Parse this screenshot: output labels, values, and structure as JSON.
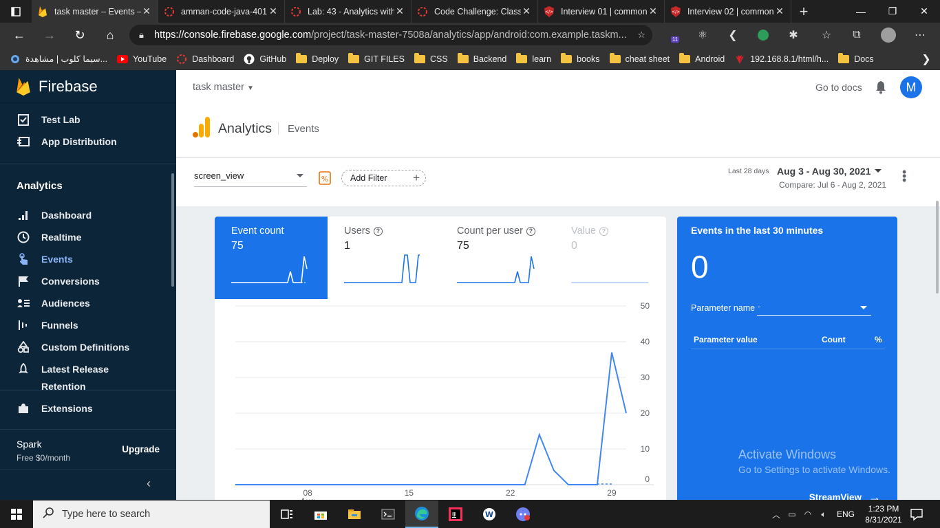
{
  "browser": {
    "tabs": [
      {
        "title": "task master – Events –",
        "icon": "firebase-icon",
        "active": true
      },
      {
        "title": "amman-code-java-401",
        "icon": "loading-ring-icon"
      },
      {
        "title": "Lab: 43 - Analytics with",
        "icon": "loading-ring-icon"
      },
      {
        "title": "Code Challenge: Class",
        "icon": "loading-ring-icon"
      },
      {
        "title": "Interview 01 | common",
        "icon": "code-shield-icon"
      },
      {
        "title": "Interview 02 | common",
        "icon": "code-shield-icon"
      }
    ],
    "url_host": "https://console.firebase.google.com",
    "url_path": "/project/task-master-7508a/analytics/app/android:com.example.taskm...",
    "extension_badge": "11",
    "bookmarks": [
      {
        "label": "سيما كلوب | مشاهدة...",
        "icon": "globe-icon"
      },
      {
        "label": "YouTube",
        "icon": "youtube-icon"
      },
      {
        "label": "Dashboard",
        "icon": "loading-ring-icon"
      },
      {
        "label": "GitHub",
        "icon": "github-icon"
      },
      {
        "label": "Deploy",
        "icon": "folder-icon"
      },
      {
        "label": "GIT FILES",
        "icon": "folder-icon"
      },
      {
        "label": "CSS",
        "icon": "folder-icon"
      },
      {
        "label": "Backend",
        "icon": "folder-icon"
      },
      {
        "label": "learn",
        "icon": "folder-icon"
      },
      {
        "label": "books",
        "icon": "folder-icon"
      },
      {
        "label": "cheat sheet",
        "icon": "folder-icon"
      },
      {
        "label": "Android",
        "icon": "folder-icon"
      },
      {
        "label": "192.168.8.1/html/h...",
        "icon": "huawei-icon"
      },
      {
        "label": "Docs",
        "icon": "folder-icon"
      }
    ]
  },
  "sidebar": {
    "brand": "Firebase",
    "items_top": [
      {
        "label": "Test Lab",
        "icon": "checklist-icon"
      },
      {
        "label": "App Distribution",
        "icon": "app-distribution-icon"
      }
    ],
    "section": "Analytics",
    "items": [
      {
        "label": "Dashboard",
        "icon": "bar-chart-icon"
      },
      {
        "label": "Realtime",
        "icon": "clock-icon"
      },
      {
        "label": "Events",
        "icon": "touch-icon",
        "active": true
      },
      {
        "label": "Conversions",
        "icon": "flag-icon"
      },
      {
        "label": "Audiences",
        "icon": "audience-icon"
      },
      {
        "label": "Funnels",
        "icon": "funnel-icon"
      },
      {
        "label": "Custom Definitions",
        "icon": "shapes-icon"
      },
      {
        "label": "Latest Release",
        "icon": "rocket-icon"
      },
      {
        "label": "Retention",
        "icon": "retention-icon"
      }
    ],
    "extensions": "Extensions",
    "plan_name": "Spark",
    "plan_price": "Free $0/month",
    "upgrade": "Upgrade"
  },
  "header": {
    "project": "task master",
    "docs": "Go to docs",
    "avatar_letter": "M",
    "title": "Analytics",
    "subtitle": "Events"
  },
  "filters": {
    "event": "screen_view",
    "add_filter": "Add Filter",
    "range_label": "Last 28 days",
    "range": "Aug 3 - Aug 30, 2021",
    "compare": "Compare: Jul 6 - Aug 2, 2021"
  },
  "metrics": [
    {
      "label": "Event count",
      "value": "75",
      "active": true,
      "help": false
    },
    {
      "label": "Users",
      "value": "1",
      "help": true
    },
    {
      "label": "Count per user",
      "value": "75",
      "help": true
    },
    {
      "label": "Value",
      "value": "0",
      "help": true,
      "dimmed": true
    }
  ],
  "chart_data": {
    "type": "line",
    "x": [
      "Aug 3",
      "Aug 4",
      "Aug 5",
      "Aug 6",
      "Aug 7",
      "Aug 8",
      "Aug 9",
      "Aug 10",
      "Aug 11",
      "Aug 12",
      "Aug 13",
      "Aug 14",
      "Aug 15",
      "Aug 16",
      "Aug 17",
      "Aug 18",
      "Aug 19",
      "Aug 20",
      "Aug 21",
      "Aug 22",
      "Aug 23",
      "Aug 24",
      "Aug 25",
      "Aug 26",
      "Aug 27",
      "Aug 28",
      "Aug 29",
      "Aug 30"
    ],
    "values": [
      0,
      0,
      0,
      0,
      0,
      0,
      0,
      0,
      0,
      0,
      0,
      0,
      0,
      0,
      0,
      0,
      0,
      0,
      0,
      0,
      0,
      14,
      4,
      0,
      0,
      0,
      37,
      20
    ],
    "x_tick_labels": [
      "08",
      "15",
      "22",
      "29"
    ],
    "x_tick_sublabel": "Aug",
    "y_ticks": [
      0,
      10,
      20,
      30,
      40,
      50
    ],
    "ylim": [
      0,
      50
    ],
    "grid": true,
    "color": "#4285f4"
  },
  "realtime": {
    "title": "Events in the last 30 minutes",
    "count": "0",
    "param_label": "Parameter name",
    "param_value": "-",
    "col_value": "Parameter value",
    "col_count": "Count",
    "col_pct": "%",
    "streamview": "StreamView"
  },
  "watermark": {
    "line1": "Activate Windows",
    "line2": "Go to Settings to activate Windows."
  },
  "taskbar": {
    "search_placeholder": "Type here to search",
    "lang": "ENG",
    "time": "1:23 PM",
    "date": "8/31/2021"
  }
}
